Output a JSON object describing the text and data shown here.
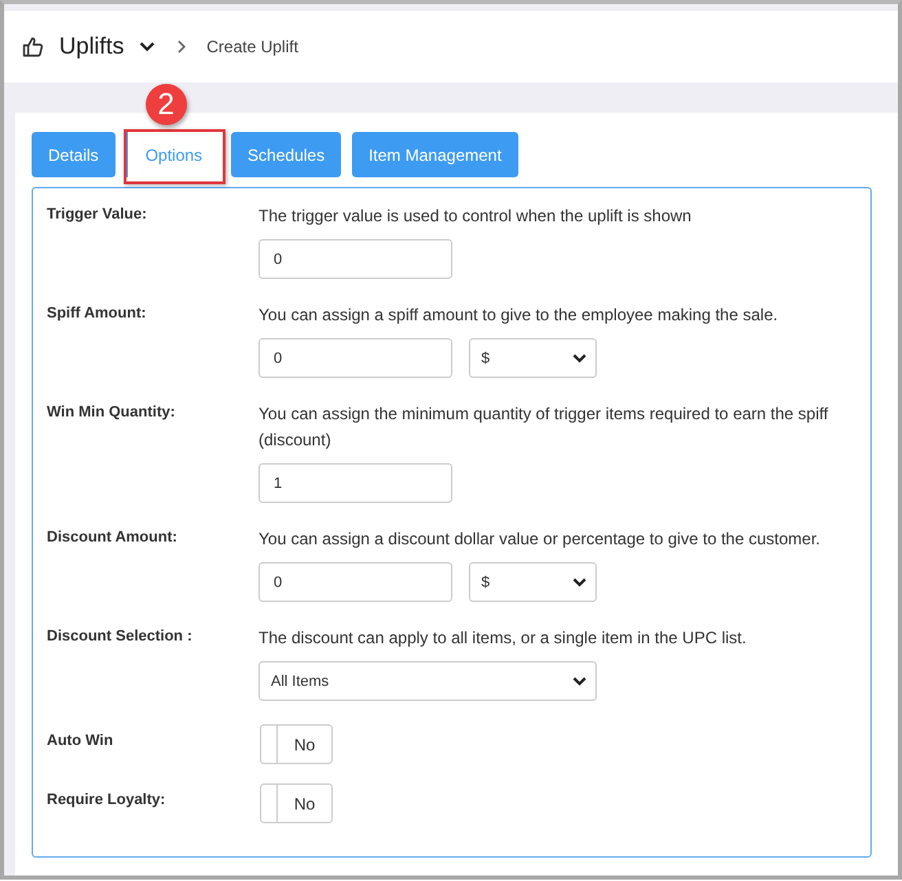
{
  "breadcrumb": {
    "section": "Uplifts",
    "page": "Create Uplift"
  },
  "callout": {
    "label": "2"
  },
  "tabs": [
    {
      "label": "Details",
      "selected": false,
      "highlighted": false
    },
    {
      "label": "Options",
      "selected": true,
      "highlighted": true
    },
    {
      "label": "Schedules",
      "selected": false,
      "highlighted": false
    },
    {
      "label": "Item Management",
      "selected": false,
      "highlighted": false
    }
  ],
  "fields": [
    {
      "kind": "text",
      "label": "Trigger Value:",
      "description": "The trigger value is used to control when the uplift is shown",
      "value": "0"
    },
    {
      "kind": "text_unit",
      "label": "Spiff Amount:",
      "description": "You can assign a spiff amount to give to the employee making the sale.",
      "value": "0",
      "unit": "$"
    },
    {
      "kind": "text",
      "label": "Win Min Quantity:",
      "description": "You can assign the minimum quantity of trigger items required to earn the spiff (discount)",
      "value": "1"
    },
    {
      "kind": "text_unit",
      "label": "Discount Amount:",
      "description": "You can assign a discount dollar value or percentage to give to the customer.",
      "value": "0",
      "unit": "$"
    },
    {
      "kind": "select",
      "label": "Discount Selection :",
      "description": "The discount can apply to all items, or a single item in the UPC list.",
      "value": "All Items"
    },
    {
      "kind": "toggle",
      "label": "Auto Win",
      "on": false,
      "state_text": "No"
    },
    {
      "kind": "toggle",
      "label": "Require Loyalty:",
      "on": false,
      "state_text": "No"
    }
  ]
}
